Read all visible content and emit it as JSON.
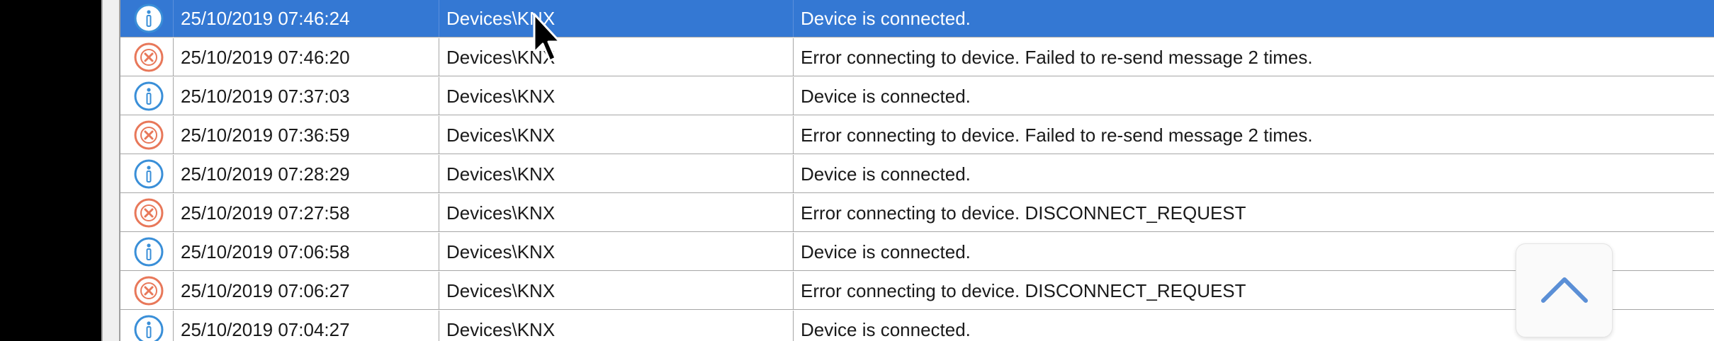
{
  "colors": {
    "selected_row": "#3478d3",
    "info_icon": "#3a8fd8",
    "error_icon": "#e8785a",
    "grid_line": "#a6a6a6"
  },
  "scroll_button": {
    "icon": "chevron-up-icon"
  },
  "log": {
    "rows": [
      {
        "type": "info",
        "icon": "info-icon",
        "time": "25/10/2019 07:46:24",
        "source": "Devices\\KNX",
        "message": "Device is connected.",
        "selected": true
      },
      {
        "type": "error",
        "icon": "error-icon",
        "time": "25/10/2019 07:46:20",
        "source": "Devices\\KNX",
        "message": "Error connecting to device. Failed to re-send message 2 times.",
        "selected": false
      },
      {
        "type": "info",
        "icon": "info-icon",
        "time": "25/10/2019 07:37:03",
        "source": "Devices\\KNX",
        "message": "Device is connected.",
        "selected": false
      },
      {
        "type": "error",
        "icon": "error-icon",
        "time": "25/10/2019 07:36:59",
        "source": "Devices\\KNX",
        "message": "Error connecting to device. Failed to re-send message 2 times.",
        "selected": false
      },
      {
        "type": "info",
        "icon": "info-icon",
        "time": "25/10/2019 07:28:29",
        "source": "Devices\\KNX",
        "message": "Device is connected.",
        "selected": false
      },
      {
        "type": "error",
        "icon": "error-icon",
        "time": "25/10/2019 07:27:58",
        "source": "Devices\\KNX",
        "message": "Error connecting to device. DISCONNECT_REQUEST",
        "selected": false
      },
      {
        "type": "info",
        "icon": "info-icon",
        "time": "25/10/2019 07:06:58",
        "source": "Devices\\KNX",
        "message": "Device is connected.",
        "selected": false
      },
      {
        "type": "error",
        "icon": "error-icon",
        "time": "25/10/2019 07:06:27",
        "source": "Devices\\KNX",
        "message": "Error connecting to device. DISCONNECT_REQUEST",
        "selected": false
      },
      {
        "type": "info",
        "icon": "info-icon",
        "time": "25/10/2019 07:04:27",
        "source": "Devices\\KNX",
        "message": "Device is connected.",
        "selected": false
      }
    ]
  }
}
